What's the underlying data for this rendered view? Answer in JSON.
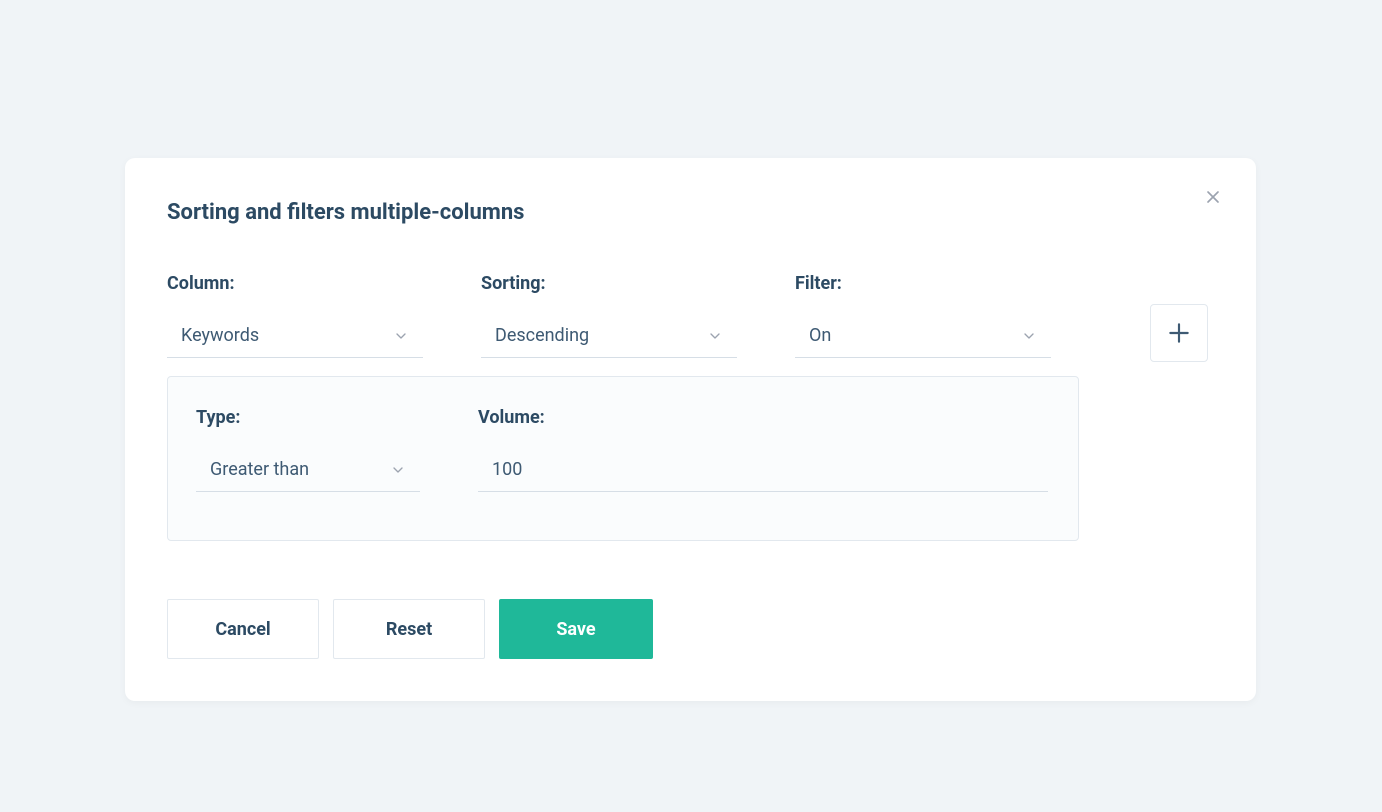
{
  "modal": {
    "title": "Sorting and filters multiple-columns",
    "labels": {
      "column": "Column:",
      "sorting": "Sorting:",
      "filter": "Filter:"
    },
    "values": {
      "column": "Keywords",
      "sorting": "Descending",
      "filter": "On"
    },
    "sub": {
      "labels": {
        "type": "Type:",
        "volume": "Volume:"
      },
      "values": {
        "type": "Greater than",
        "volume": "100"
      }
    },
    "buttons": {
      "cancel": "Cancel",
      "reset": "Reset",
      "save": "Save"
    }
  }
}
